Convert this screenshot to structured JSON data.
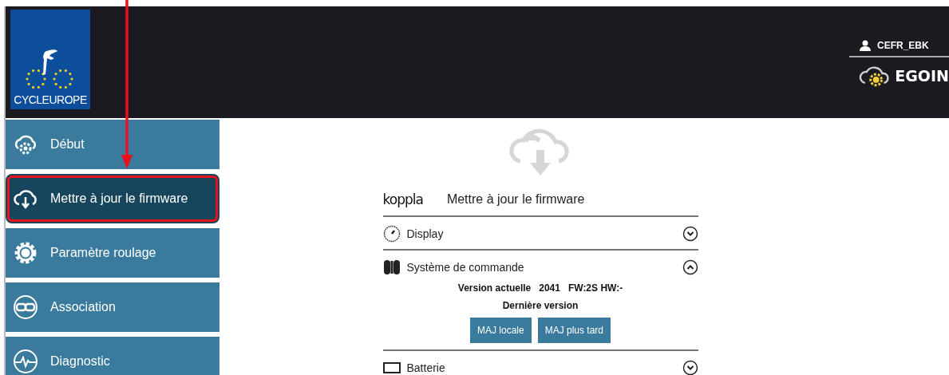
{
  "header": {
    "logo_text": "CYCLEUROPE",
    "user": "CEFR_EBK",
    "app_name": "EGOIN"
  },
  "sidebar": {
    "items": [
      {
        "label": "Début",
        "selected": false,
        "annotated": false
      },
      {
        "label": "Mettre à jour le firmware",
        "selected": true,
        "annotated": true
      },
      {
        "label": "Paramètre roulage",
        "selected": false,
        "annotated": false
      },
      {
        "label": "Association",
        "selected": false,
        "annotated": false
      },
      {
        "label": "Diagnostic",
        "selected": false,
        "annotated": false
      }
    ]
  },
  "content": {
    "brand": "koppla",
    "title": "Mettre à jour le firmware",
    "sections": [
      {
        "label": "Display",
        "expanded": false
      },
      {
        "label": "Système de commande",
        "expanded": true,
        "current_label": "Version actuelle",
        "current_value": "2041",
        "current_detail": "FW:2S HW:-",
        "latest_label": "Dernière version",
        "buttons": [
          "MAJ locale",
          "MAJ plus tard"
        ]
      },
      {
        "label": "Batterie",
        "expanded": false
      }
    ]
  }
}
